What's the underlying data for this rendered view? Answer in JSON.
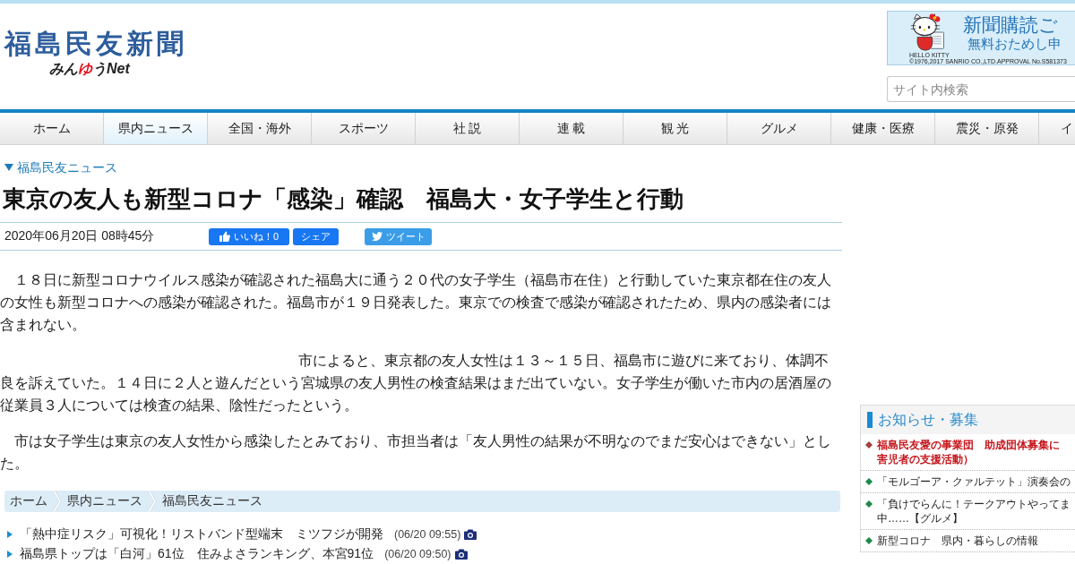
{
  "header": {
    "logo": {
      "title": "福島民友新聞",
      "subtitle_parts": [
        {
          "text": "みん",
          "accent": false
        },
        {
          "text": "ゆ",
          "accent": true
        },
        {
          "text": "うNet",
          "accent": false
        }
      ]
    },
    "ad_banner": {
      "headline": "新聞購読ご",
      "subline": "無料おためし申",
      "credit_lines": [
        "HELLO KITTY",
        "©1976,2017 SANRIO CO.,LTD.APPROVAL No.S581373"
      ]
    },
    "search": {
      "placeholder": "サイト内検索"
    }
  },
  "nav": {
    "tabs": [
      {
        "label": "ホーム",
        "selected": false
      },
      {
        "label": "県内ニュース",
        "selected": true
      },
      {
        "label": "全国・海外",
        "selected": false
      },
      {
        "label": "スポーツ",
        "selected": false
      },
      {
        "label": "社 説",
        "selected": false
      },
      {
        "label": "連 載",
        "selected": false
      },
      {
        "label": "観 光",
        "selected": false
      },
      {
        "label": "グルメ",
        "selected": false
      },
      {
        "label": "健康・医療",
        "selected": false
      },
      {
        "label": "震災・原発",
        "selected": false
      },
      {
        "label": "イ",
        "selected": false
      }
    ]
  },
  "article": {
    "category": "福島民友ニュース",
    "title": "東京の友人も新型コロナ「感染」確認　福島大・女子学生と行動",
    "date": "2020年06月20日 08時45分",
    "share_buttons": [
      {
        "kind": "like",
        "label": "いいね！0"
      },
      {
        "kind": "share",
        "label": "シェア"
      },
      {
        "kind": "tweet",
        "label": "ツイート"
      }
    ],
    "paragraphs": [
      {
        "text": "１８日に新型コロナウイルス感染が確認された福島大に通う２０代の女子学生（福島市在住）と行動していた東京都在住の友人の女性も新型コロナへの感染が確認された。福島市が１９日発表した。東京での検査で感染が確認されたため、県内の感染者には含まれない。",
        "leading_blank": false
      },
      {
        "text": "市によると、東京都の友人女性は１３～１５日、福島市に遊びに来ており、体調不良を訴えていた。１４日に２人と遊んだという宮城県の友人男性の検査結果はまだ出ていない。女子学生が働いた市内の居酒屋の従業員３人については検査の結果、陰性だったという。",
        "leading_blank": true
      },
      {
        "text": "市は女子学生は東京の友人女性から感染したとみており、市担当者は「友人男性の結果が不明なのでまだ安心はできない」とした。",
        "leading_blank": false
      }
    ]
  },
  "breadcrumb": [
    "ホーム",
    "県内ニュース",
    "福島民友ニュース"
  ],
  "related": [
    {
      "title": "「熱中症リスク」可視化！リストバンド型端末　ミツフジが開発",
      "time": "(06/20 09:55)",
      "has_photo": true
    },
    {
      "title": "福島県トップは「白河」61位　住みよさランキング、本宮91位",
      "time": "(06/20 09:50)",
      "has_photo": true
    }
  ],
  "sidebar": {
    "title": "お知らせ・募集",
    "items": [
      {
        "lines": [
          "福島民友愛の事業団　助成団体募集に",
          "害児者の支援活動）"
        ],
        "important": true
      },
      {
        "lines": [
          "「モルゴーア・クァルテット」演奏会の"
        ],
        "important": false
      },
      {
        "lines": [
          "「負けでらんに！テークアウトやってま",
          "中……【グルメ】"
        ],
        "important": false
      },
      {
        "lines": [
          "新型コロナ　県内・暮らしの情報"
        ],
        "important": false
      }
    ]
  }
}
